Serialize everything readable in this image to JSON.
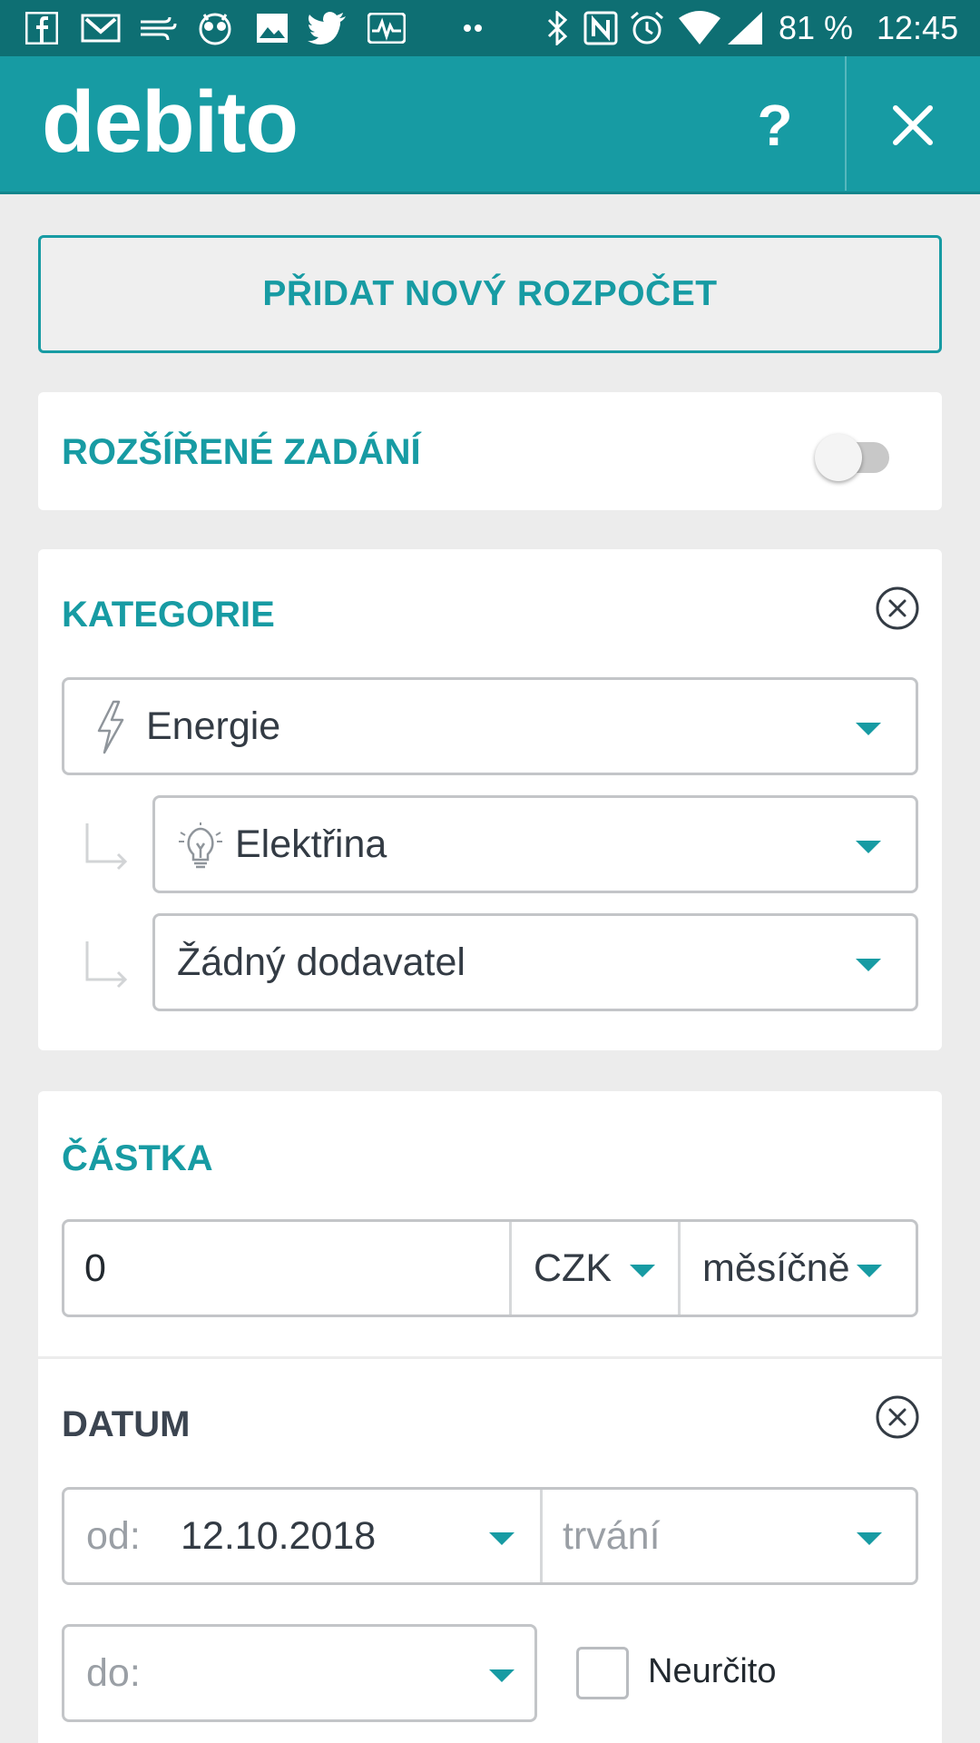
{
  "status_bar": {
    "battery": "81 %",
    "time": "12:45",
    "left_icons": [
      "facebook-icon",
      "gmail-icon",
      "wind-icon",
      "owl-icon",
      "image-icon",
      "twitter-icon",
      "pulse-icon",
      "more-dots-icon"
    ],
    "right_icons": [
      "bluetooth-icon",
      "nfc-icon",
      "alarm-icon",
      "wifi-icon",
      "signal-icon"
    ]
  },
  "app_bar": {
    "logo": "debito",
    "help_label": "?",
    "close_icon": "close-icon"
  },
  "add_budget_label": "PŘIDAT NOVÝ ROZPOČET",
  "advanced": {
    "title": "ROZŠÍŘENÉ ZADÁNÍ",
    "enabled": false
  },
  "category": {
    "title": "KATEGORIE",
    "main": {
      "icon": "lightning-icon",
      "value": "Energie"
    },
    "sub": {
      "icon": "lightbulb-icon",
      "value": "Elektřina"
    },
    "supplier": {
      "value": "Žádný dodavatel"
    }
  },
  "amount": {
    "title": "ČÁSTKA",
    "value": "0",
    "currency": "CZK",
    "period": "měsíčně"
  },
  "date": {
    "title": "DATUM",
    "from_label": "od:",
    "from_value": "12.10.2018",
    "duration_placeholder": "trvání",
    "to_placeholder": "do:",
    "indefinite_label": "Neurčito",
    "indefinite_checked": false
  },
  "colors": {
    "accent": "#179ba3",
    "status_bar": "#0e6f73",
    "background": "#ececec"
  }
}
